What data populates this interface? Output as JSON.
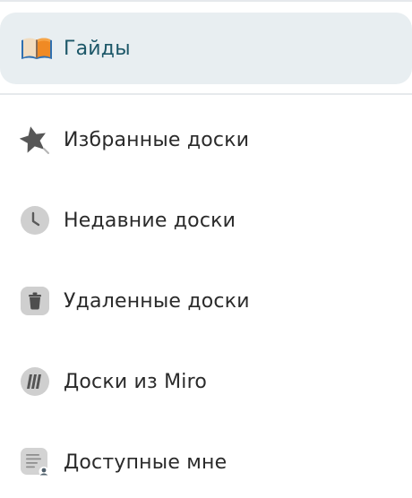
{
  "menu": {
    "guides": {
      "label": "Гайды",
      "icon": "open-book-icon"
    },
    "items": [
      {
        "label": "Избранные доски",
        "icon": "star-icon"
      },
      {
        "label": "Недавние доски",
        "icon": "clock-icon"
      },
      {
        "label": "Удаленные доски",
        "icon": "trash-icon"
      },
      {
        "label": "Доски из Miro",
        "icon": "miro-icon"
      },
      {
        "label": "Доступные мне",
        "icon": "shared-document-icon"
      }
    ]
  },
  "colors": {
    "highlight_bg": "#e8eef1",
    "highlight_text": "#1c5768",
    "text": "#2a2a2a",
    "icon_gray": "#c9c9c9",
    "icon_dark": "#5a5a5a",
    "divider": "#e6e9ec"
  }
}
